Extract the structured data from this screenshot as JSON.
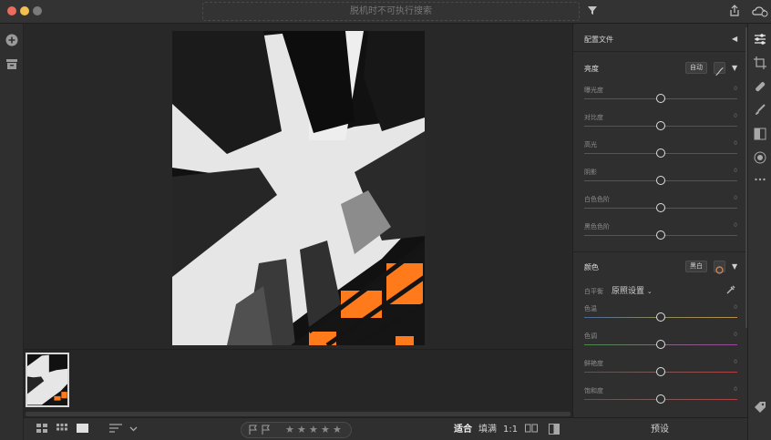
{
  "titlebar": {
    "search_placeholder": "脱机时不可执行搜索",
    "colors": {
      "close": "#ec6a5e",
      "minimize": "#f4bf4f",
      "zoom": "#7b7b7b"
    }
  },
  "bottombar": {
    "zoom_fit": "适合",
    "zoom_fill": "填满",
    "zoom_1to1": "1:1",
    "stars": [
      "★",
      "★",
      "★",
      "★",
      "★"
    ]
  },
  "panel": {
    "title": "配置文件",
    "light": {
      "title": "亮度",
      "auto_label": "自动",
      "sliders": [
        {
          "label": "曝光度",
          "value": "0"
        },
        {
          "label": "对比度",
          "value": "0"
        },
        {
          "label": "高光",
          "value": "0"
        },
        {
          "label": "阴影",
          "value": "0"
        },
        {
          "label": "白色色阶",
          "value": "0"
        },
        {
          "label": "黑色色阶",
          "value": "0"
        }
      ]
    },
    "color": {
      "title": "颜色",
      "bw_label": "黑白",
      "wb_label": "白平衡",
      "wb_value": "原照设置",
      "sliders": [
        {
          "label": "色温",
          "value": "0"
        },
        {
          "label": "色调",
          "value": "0"
        },
        {
          "label": "鲜艳度",
          "value": "0"
        },
        {
          "label": "饱和度",
          "value": "0"
        }
      ]
    }
  },
  "presets_label": "预设",
  "icons": {
    "add": "plus-circle-icon",
    "archive": "archive-icon",
    "filter": "filter-icon",
    "share": "share-icon",
    "cloud": "cloud-sync-icon"
  },
  "accent": "#ff7a1a"
}
